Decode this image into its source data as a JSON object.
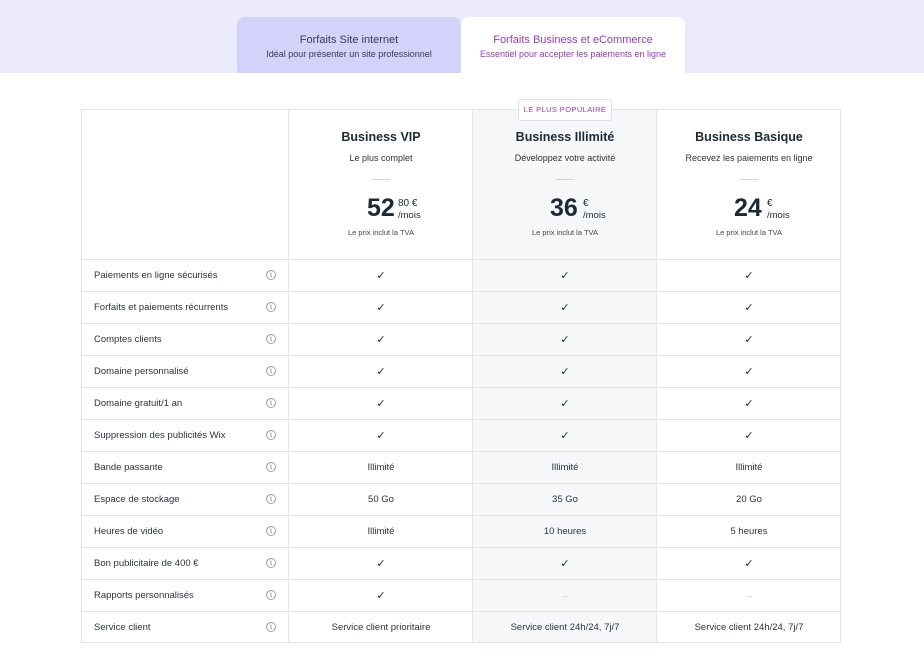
{
  "tabs": [
    {
      "title": "Forfaits Site internet",
      "subtitle": "Idéal pour présenter un site professionnel"
    },
    {
      "title": "Forfaits Business et eCommerce",
      "subtitle": "Essentiel pour accepter les paiements en ligne"
    }
  ],
  "badge": "LE PLUS POPULAIRE",
  "plans": [
    {
      "name": "Business VIP",
      "desc": "Le plus complet",
      "price_int": "52",
      "price_dec": "80 €",
      "period": "/mois",
      "vat": "Le prix inclut la TVA"
    },
    {
      "name": "Business Illimité",
      "desc": "Développez votre activité",
      "price_int": "36",
      "price_dec": "€",
      "period": "/mois",
      "vat": "Le prix inclut la TVA"
    },
    {
      "name": "Business Basique",
      "desc": "Recevez les paiements en ligne",
      "price_int": "24",
      "price_dec": "€",
      "period": "/mois",
      "vat": "Le prix inclut la TVA"
    }
  ],
  "icons": {
    "check": "check-icon",
    "info": "info-icon"
  },
  "colors": {
    "accent": "#9b3ac3",
    "band": "#ebebfc",
    "tab_inactive": "#d2d2fa"
  },
  "rows": [
    {
      "feature": "Paiements en ligne sécurisés",
      "values": [
        "✓",
        "✓",
        "✓"
      ]
    },
    {
      "feature": "Forfaits et paiements récurrents",
      "values": [
        "✓",
        "✓",
        "✓"
      ]
    },
    {
      "feature": "Comptes clients",
      "values": [
        "✓",
        "✓",
        "✓"
      ]
    },
    {
      "feature": "Domaine personnalisé",
      "values": [
        "✓",
        "✓",
        "✓"
      ]
    },
    {
      "feature": "Domaine gratuit/1 an",
      "values": [
        "✓",
        "✓",
        "✓"
      ]
    },
    {
      "feature": "Suppression des publicités Wix",
      "values": [
        "✓",
        "✓",
        "✓"
      ]
    },
    {
      "feature": "Bande passante",
      "values": [
        "Illimité",
        "Illimité",
        "Illimité"
      ]
    },
    {
      "feature": "Espace de stockage",
      "values": [
        "50 Go",
        "35 Go",
        "20 Go"
      ]
    },
    {
      "feature": "Heures de vidéo",
      "values": [
        "Illimité",
        "10 heures",
        "5 heures"
      ]
    },
    {
      "feature": "Bon publicitaire de 400 €",
      "values": [
        "✓",
        "✓",
        "✓"
      ]
    },
    {
      "feature": "Rapports personnalisés",
      "values": [
        "✓",
        "–",
        "–"
      ]
    },
    {
      "feature": "Service client",
      "values": [
        "Service client prioritaire",
        "Service client 24h/24, 7j/7",
        "Service client 24h/24, 7j/7"
      ]
    }
  ]
}
